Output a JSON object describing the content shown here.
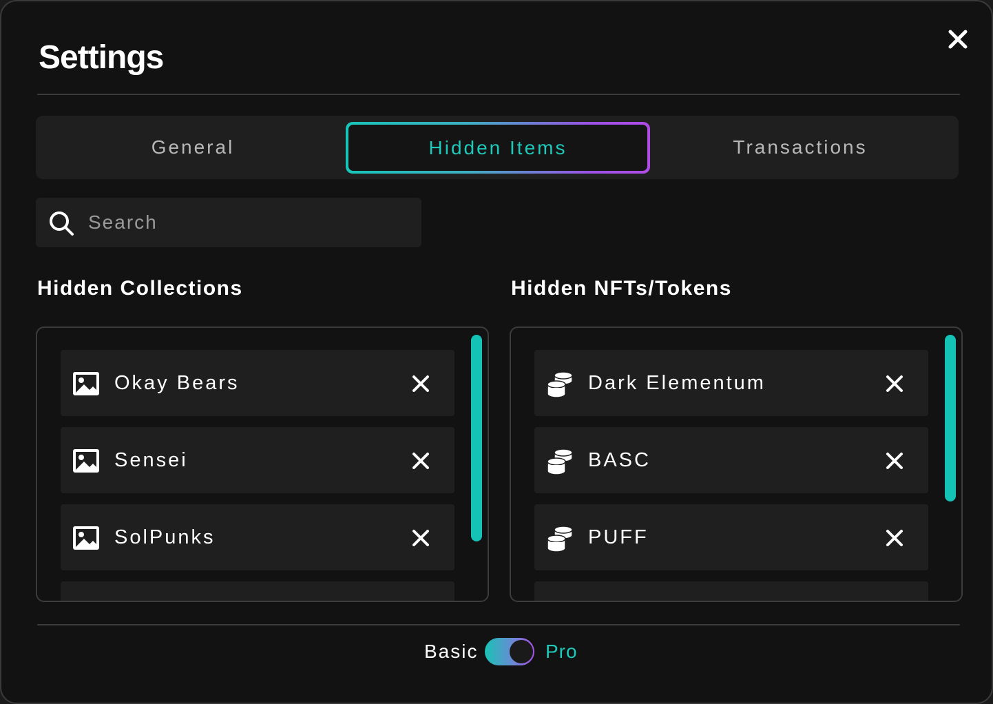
{
  "modal": {
    "title": "Settings",
    "close_icon": "close-icon"
  },
  "tabs": [
    {
      "label": "General",
      "active": false
    },
    {
      "label": "Hidden Items",
      "active": true
    },
    {
      "label": "Transactions",
      "active": false
    }
  ],
  "search": {
    "placeholder": "Search",
    "value": "",
    "icon": "search-icon"
  },
  "hidden_collections": {
    "title": "Hidden Collections",
    "item_icon": "image-icon",
    "items": [
      {
        "label": "Okay Bears"
      },
      {
        "label": "Sensei"
      },
      {
        "label": "SolPunks"
      }
    ]
  },
  "hidden_tokens": {
    "title": "Hidden NFTs/Tokens",
    "item_icon": "coins-icon",
    "items": [
      {
        "label": "Dark Elementum"
      },
      {
        "label": "BASC"
      },
      {
        "label": "PUFF"
      }
    ]
  },
  "mode_toggle": {
    "left_label": "Basic",
    "right_label": "Pro",
    "selected": "Pro"
  },
  "colors": {
    "accent": "#1ec9b9",
    "gradient_start": "#17c6b8",
    "gradient_end": "#b04be6",
    "background": "#121212",
    "surface": "#1f1f1f"
  }
}
